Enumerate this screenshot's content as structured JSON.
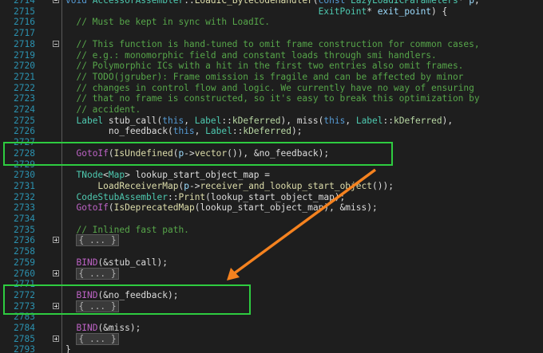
{
  "editor": {
    "lines": [
      {
        "n": "2714",
        "fold": "minus",
        "tokens": [
          [
            "k",
            "void "
          ],
          [
            "t",
            "AccessorAssembler"
          ],
          [
            "",
            "::"
          ],
          [
            "f",
            "LoadIC_BytecodeHandler"
          ],
          [
            "",
            "("
          ],
          [
            "k",
            "const "
          ],
          [
            "t",
            "LazyLoadICParameters"
          ],
          [
            "",
            "* "
          ],
          [
            "p",
            "p"
          ],
          [
            "",
            ","
          ]
        ]
      },
      {
        "n": "2715",
        "fold": "",
        "tokens": [
          [
            "",
            "                                               "
          ],
          [
            "t",
            "ExitPoint"
          ],
          [
            "",
            "* "
          ],
          [
            "p",
            "exit_point"
          ],
          [
            "",
            ") {"
          ]
        ]
      },
      {
        "n": "2716",
        "fold": "",
        "tokens": [
          [
            "c",
            "  // Must be kept in sync with LoadIC."
          ]
        ]
      },
      {
        "n": "2717",
        "fold": "",
        "tokens": []
      },
      {
        "n": "2718",
        "fold": "minus",
        "tokens": [
          [
            "c",
            "  // This function is hand-tuned to omit frame construction for common cases,"
          ]
        ]
      },
      {
        "n": "2719",
        "fold": "",
        "tokens": [
          [
            "c",
            "  // e.g.: monomorphic field and constant loads through smi handlers."
          ]
        ]
      },
      {
        "n": "2720",
        "fold": "",
        "tokens": [
          [
            "c",
            "  // Polymorphic ICs with a hit in the first two entries also omit frames."
          ]
        ]
      },
      {
        "n": "2721",
        "fold": "",
        "tokens": [
          [
            "c",
            "  // TODO(jgruber): Frame omission is fragile and can be affected by minor"
          ]
        ]
      },
      {
        "n": "2722",
        "fold": "",
        "tokens": [
          [
            "c",
            "  // changes in control flow and logic. We currently have no way of ensuring"
          ]
        ]
      },
      {
        "n": "2723",
        "fold": "",
        "tokens": [
          [
            "c",
            "  // that no frame is constructed, so it's easy to break this optimization by"
          ]
        ]
      },
      {
        "n": "2724",
        "fold": "",
        "tokens": [
          [
            "c",
            "  // accident."
          ]
        ]
      },
      {
        "n": "2725",
        "fold": "",
        "tokens": [
          [
            "",
            "  "
          ],
          [
            "t",
            "Label"
          ],
          [
            "",
            ""
          ],
          [
            "",
            ""
          ],
          [
            "",
            ""
          ],
          [
            "",
            ""
          ],
          [
            "",
            ""
          ],
          [
            "",
            ""
          ],
          [
            "",
            ""
          ],
          [
            "",
            ""
          ],
          [
            "",
            ""
          ],
          [
            "",
            ""
          ],
          [
            "",
            ""
          ],
          [
            "",
            ""
          ],
          [
            "",
            ""
          ],
          [
            "",
            ""
          ],
          [
            "",
            ""
          ],
          [
            "",
            ""
          ],
          [
            "",
            ""
          ],
          [
            "",
            ""
          ],
          [
            "",
            ""
          ],
          [
            "",
            ""
          ],
          [
            "",
            ""
          ],
          [
            "",
            ""
          ],
          [
            "",
            ""
          ],
          [
            "",
            ""
          ],
          [
            "",
            ""
          ],
          [
            "",
            ""
          ],
          [
            "",
            ""
          ],
          [
            "",
            ""
          ],
          [
            "",
            ""
          ],
          [
            "",
            ""
          ],
          [
            "",
            ""
          ],
          [
            "",
            ""
          ],
          [
            "",
            ""
          ],
          [
            "",
            ""
          ],
          [
            "",
            ""
          ],
          [
            "",
            ""
          ],
          [
            "",
            ""
          ],
          [
            "",
            ""
          ],
          [
            "",
            ""
          ],
          [
            "",
            ""
          ],
          [
            "",
            ""
          ],
          [
            "",
            ""
          ],
          [
            "",
            ""
          ],
          [
            "",
            ""
          ],
          [
            "",
            ""
          ],
          [
            "",
            ""
          ],
          [
            "",
            ""
          ],
          [
            "",
            ""
          ],
          [
            "",
            ""
          ],
          [
            "",
            ""
          ],
          [
            "",
            ""
          ],
          [
            "",
            ""
          ],
          [
            "",
            ""
          ],
          [
            "",
            ""
          ],
          [
            "",
            ""
          ],
          [
            "",
            ""
          ],
          [
            "",
            ""
          ],
          [
            "",
            ""
          ],
          [
            "",
            ""
          ],
          [
            "",
            ""
          ],
          [
            "",
            ""
          ],
          [
            "",
            ""
          ],
          [
            "",
            ""
          ],
          [
            "",
            ""
          ],
          [
            "",
            ""
          ],
          [
            "",
            ""
          ],
          [
            "",
            ""
          ],
          [
            "",
            ""
          ],
          [
            "",
            ""
          ],
          [
            "",
            ""
          ],
          [
            "",
            ""
          ],
          [
            "",
            ""
          ],
          [
            "",
            ""
          ],
          [
            "",
            ""
          ],
          [
            "",
            ""
          ],
          [
            "",
            ""
          ],
          [
            "",
            ""
          ],
          [
            "",
            ""
          ],
          [
            "",
            ""
          ],
          [
            "",
            ""
          ],
          [
            "",
            ""
          ],
          [
            "",
            ""
          ],
          [
            "",
            ""
          ],
          [
            "",
            ""
          ],
          [
            "",
            ""
          ],
          [
            "",
            ""
          ],
          [
            "",
            ""
          ],
          [
            "",
            ""
          ],
          [
            "",
            ""
          ],
          [
            "",
            ""
          ],
          [
            "",
            ""
          ],
          [
            "",
            ""
          ],
          [
            "",
            ""
          ],
          [
            "",
            ""
          ],
          [
            "",
            ""
          ],
          [
            "",
            ""
          ],
          [
            "",
            ""
          ],
          [
            "",
            ""
          ],
          [
            "",
            ""
          ],
          [
            "",
            ""
          ],
          [
            "",
            ""
          ],
          [
            "",
            ""
          ],
          [
            "",
            ""
          ],
          [
            "",
            ""
          ],
          [
            "",
            " stub_call("
          ],
          [
            "th",
            "this"
          ],
          [
            "",
            ", "
          ],
          [
            "t",
            "Label"
          ],
          [
            "",
            "::"
          ],
          [
            "m",
            "kDeferred"
          ],
          [
            "",
            "), miss("
          ],
          [
            "th",
            "this"
          ],
          [
            "",
            ", "
          ],
          [
            "t",
            "Label"
          ],
          [
            "",
            "::"
          ],
          [
            "m",
            "kDeferred"
          ],
          [
            "",
            "),"
          ]
        ]
      },
      {
        "n": "2726",
        "fold": "",
        "tokens": [
          [
            "",
            "        no_feedback("
          ],
          [
            "th",
            "this"
          ],
          [
            "",
            ", "
          ],
          [
            "t",
            "Label"
          ],
          [
            "",
            "::"
          ],
          [
            "m",
            "kDeferred"
          ],
          [
            "",
            ");"
          ]
        ]
      },
      {
        "n": "2727",
        "fold": "",
        "tokens": []
      },
      {
        "n": "2728",
        "fold": "",
        "tokens": [
          [
            "",
            "  "
          ],
          [
            "v",
            "GotoIf"
          ],
          [
            "",
            "("
          ],
          [
            "f",
            "IsUndefined"
          ],
          [
            "",
            "("
          ],
          [
            "p",
            "p"
          ],
          [
            "",
            "->"
          ],
          [
            "f",
            "vector"
          ],
          [
            "",
            "()), &no_feedback);"
          ]
        ]
      },
      {
        "n": "2729",
        "fold": "",
        "tokens": []
      },
      {
        "n": "2730",
        "fold": "",
        "tokens": [
          [
            "",
            "  "
          ],
          [
            "t",
            "TNode"
          ],
          [
            "",
            "<"
          ],
          [
            "t",
            "Map"
          ],
          [
            "",
            "> lookup_start_object_map ="
          ]
        ]
      },
      {
        "n": "2731",
        "fold": "",
        "tokens": [
          [
            "",
            "      "
          ],
          [
            "f",
            "LoadReceiverMap"
          ],
          [
            "",
            "("
          ],
          [
            "p",
            "p"
          ],
          [
            "",
            "->"
          ],
          [
            "f",
            "receiver_and_lookup_start_object"
          ],
          [
            "",
            "());"
          ]
        ]
      },
      {
        "n": "2732",
        "fold": "",
        "tokens": [
          [
            "",
            "  "
          ],
          [
            "t",
            "CodeStubAssembler"
          ],
          [
            "",
            "::"
          ],
          [
            "f",
            "Print"
          ],
          [
            "",
            "(lookup_start_object_map);"
          ]
        ]
      },
      {
        "n": "2733",
        "fold": "",
        "tokens": [
          [
            "",
            "  "
          ],
          [
            "v",
            "GotoIf"
          ],
          [
            "",
            "("
          ],
          [
            "f",
            "IsDeprecatedMap"
          ],
          [
            "",
            "(lookup_start_object_map), &miss);"
          ]
        ]
      },
      {
        "n": "2734",
        "fold": "",
        "tokens": []
      },
      {
        "n": "2735",
        "fold": "",
        "tokens": [
          [
            "c",
            "  // Inlined fast path."
          ]
        ]
      },
      {
        "n": "2736",
        "fold": "plus",
        "tokens": [
          [
            "",
            "  "
          ],
          [
            "col",
            "{ ... }"
          ]
        ]
      },
      {
        "n": "2758",
        "fold": "",
        "tokens": []
      },
      {
        "n": "2759",
        "fold": "",
        "tokens": [
          [
            "",
            "  "
          ],
          [
            "v",
            "BIND"
          ],
          [
            "",
            "(&stub_call);"
          ]
        ]
      },
      {
        "n": "2760",
        "fold": "plus",
        "tokens": [
          [
            "",
            "  "
          ],
          [
            "col",
            "{ ... }"
          ]
        ]
      },
      {
        "n": "2771",
        "fold": "",
        "tokens": []
      },
      {
        "n": "2772",
        "fold": "",
        "tokens": [
          [
            "",
            "  "
          ],
          [
            "v",
            "BIND"
          ],
          [
            "",
            "(&no_feedback);"
          ]
        ]
      },
      {
        "n": "2773",
        "fold": "plus",
        "tokens": [
          [
            "",
            "  "
          ],
          [
            "col",
            "{ ... }"
          ]
        ]
      },
      {
        "n": "2783",
        "fold": "",
        "tokens": []
      },
      {
        "n": "2784",
        "fold": "",
        "tokens": [
          [
            "",
            "  "
          ],
          [
            "v",
            "BIND"
          ],
          [
            "",
            "(&miss);"
          ]
        ]
      },
      {
        "n": "2785",
        "fold": "plus",
        "tokens": [
          [
            "",
            "  "
          ],
          [
            "col",
            "{ ... }"
          ]
        ]
      },
      {
        "n": "2793",
        "fold": "",
        "tokens": [
          [
            "",
            "}"
          ]
        ]
      }
    ]
  },
  "annotations": {
    "box_color": "#2ecc40",
    "arrow_color": "#f5821f"
  }
}
